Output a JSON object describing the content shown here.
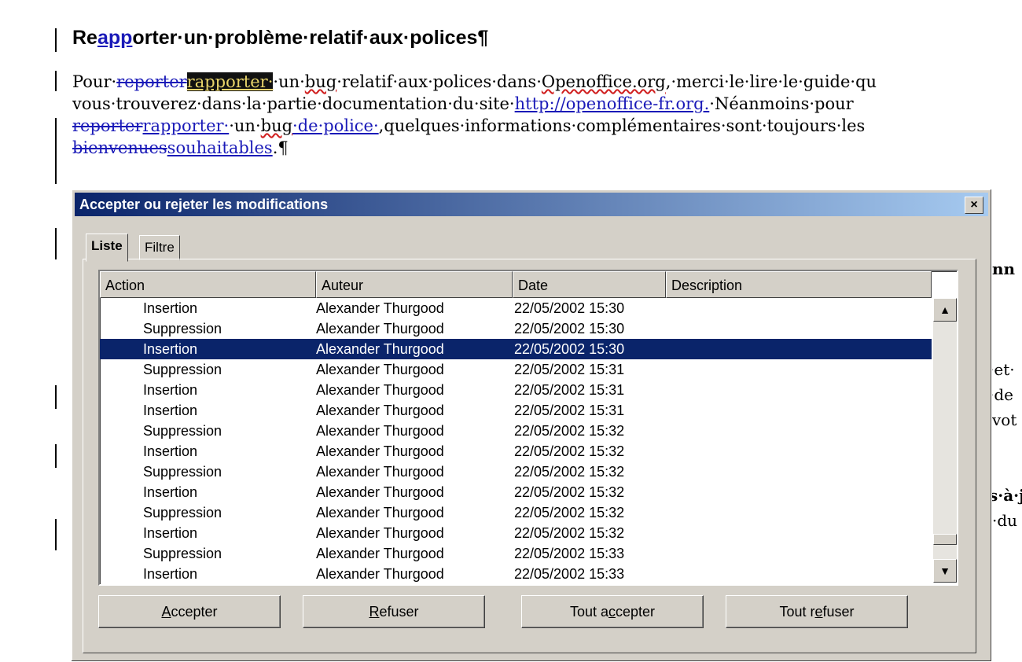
{
  "document": {
    "title_parts": [
      "Re",
      "app",
      "orter·un·problème·relatif·aux·polices¶"
    ],
    "line1": {
      "a": "Pour·",
      "del": "reporter",
      "hl": "rapporter·",
      "b": "·un·",
      "bug": "bug",
      "c": "·relatif·aux·polices·dans·",
      "oo": "Openoffice.org",
      "d": ",·merci·le·lire·le·guide·qu"
    },
    "line2": {
      "a": "vous·trouverez·dans·la·partie·documentation·du·site·",
      "link": "http://openoffice-fr.org.",
      "b": "·Néanmoins·pour"
    },
    "line3": {
      "del": "reporter",
      "ins": "rapporter·",
      "a": "·un·",
      "bug": "bug",
      "ins2": "·de·police·",
      "b": ",quelques·informations·complémentaires·sont·toujours·les"
    },
    "line4": {
      "del": "bienvenues",
      "ins": "souhaitables",
      "end": ".¶"
    },
    "right_fragments": [
      "nn",
      "·et·",
      "·de",
      "vot",
      "s·à·j",
      "·du"
    ]
  },
  "dialog": {
    "title": "Accepter ou rejeter les modifications",
    "close": "×",
    "tabs": [
      "Liste",
      "Filtre"
    ],
    "columns": [
      "Action",
      "Auteur",
      "Date",
      "Description"
    ],
    "rows": [
      {
        "action": "Insertion",
        "author": "Alexander Thurgood",
        "date": "22/05/2002 15:30"
      },
      {
        "action": "Suppression",
        "author": "Alexander Thurgood",
        "date": "22/05/2002 15:30"
      },
      {
        "action": "Insertion",
        "author": "Alexander Thurgood",
        "date": "22/05/2002 15:30"
      },
      {
        "action": "Suppression",
        "author": "Alexander Thurgood",
        "date": "22/05/2002 15:31"
      },
      {
        "action": "Insertion",
        "author": "Alexander Thurgood",
        "date": "22/05/2002 15:31"
      },
      {
        "action": "Insertion",
        "author": "Alexander Thurgood",
        "date": "22/05/2002 15:31"
      },
      {
        "action": "Suppression",
        "author": "Alexander Thurgood",
        "date": "22/05/2002 15:32"
      },
      {
        "action": "Insertion",
        "author": "Alexander Thurgood",
        "date": "22/05/2002 15:32"
      },
      {
        "action": "Suppression",
        "author": "Alexander Thurgood",
        "date": "22/05/2002 15:32"
      },
      {
        "action": "Insertion",
        "author": "Alexander Thurgood",
        "date": "22/05/2002 15:32"
      },
      {
        "action": "Suppression",
        "author": "Alexander Thurgood",
        "date": "22/05/2002 15:32"
      },
      {
        "action": "Insertion",
        "author": "Alexander Thurgood",
        "date": "22/05/2002 15:32"
      },
      {
        "action": "Suppression",
        "author": "Alexander Thurgood",
        "date": "22/05/2002 15:33"
      },
      {
        "action": "Insertion",
        "author": "Alexander Thurgood",
        "date": "22/05/2002 15:33"
      }
    ],
    "selected_row": 2,
    "scroll_up": "▲",
    "scroll_down": "▼",
    "buttons": {
      "accept": {
        "pre": "",
        "key": "A",
        "post": "ccepter"
      },
      "reject": {
        "pre": "",
        "key": "R",
        "post": "efuser"
      },
      "accept_all": {
        "pre": "Tout a",
        "key": "c",
        "post": "cepter"
      },
      "reject_all": {
        "pre": "Tout r",
        "key": "e",
        "post": "fuser"
      }
    }
  },
  "colors": {
    "selection": "#0a246a",
    "track_changes": "#1a1ab8",
    "highlight_bg": "#111111",
    "highlight_fg": "#e8d46a"
  }
}
